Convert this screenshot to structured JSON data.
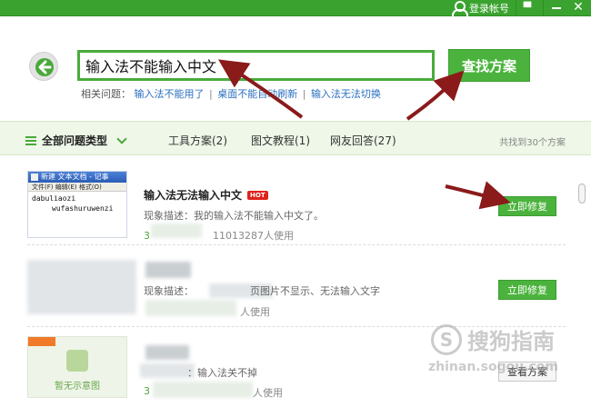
{
  "topbar": {
    "login_label": "登录帐号",
    "menu_glyph": "▀",
    "close_glyph": "✕"
  },
  "search": {
    "query": "输入法不能输入中文",
    "button_label": "查找方案"
  },
  "related": {
    "label": "相关问题：",
    "links": [
      "输入法不能用了",
      "桌面不能自动刷新",
      "输入法无法切换"
    ],
    "separator": "|"
  },
  "tabs": {
    "category_label": "全部问题类型",
    "items": [
      "工具方案(2)",
      "图文教程(1)",
      "网友回答(27)"
    ],
    "found_text": "共找到30个方案"
  },
  "results": [
    {
      "title": "输入法无法输入中文",
      "badge": "HOT",
      "description": "现象描述：我的输入法不能输入中文了。",
      "meta_prefix": "3",
      "meta_count": "11013287人使用",
      "button": "立即修复",
      "thumb": {
        "window_title": "新建 文本文档 - 记事",
        "menu": "文件(F)  编辑(E)  格式(O)",
        "line1": "dabuliaozi",
        "line2": "wufashuruwenzi"
      }
    },
    {
      "desc_prefix": "现象描述：",
      "description_visible": "页图片不显示、无法输入文字",
      "meta_suffix": "人使用",
      "button": "立即修复"
    },
    {
      "description": "：输入法关不掉",
      "meta_prefix": "3",
      "meta_suffix": "人使用",
      "button": "查看方案",
      "thumb_caption": "暂无示意图"
    }
  ],
  "watermark": {
    "logo_glyph": "S",
    "text": "搜狗指南",
    "sub": "zhinan.sogou.com"
  },
  "colors": {
    "brand_green": "#4bb33d",
    "arrow_red": "#8b1a1a",
    "hot_red": "#e0221c"
  }
}
